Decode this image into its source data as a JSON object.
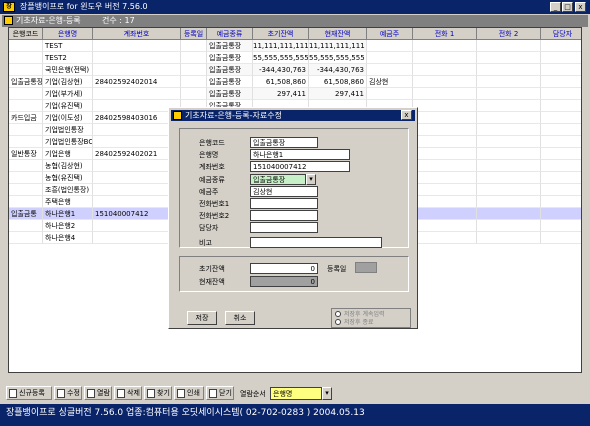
{
  "app_title": "장플뱅이프로 for 윈도우 버전 7.56.0",
  "mdi_title": "기초자료-은행-등록",
  "record_count": "건수 : 17",
  "columns": [
    "은행코드",
    "은행명",
    "계좌번호",
    "등록일",
    "예금종류",
    "초기잔액",
    "현재잔액",
    "예금주",
    "전화 1",
    "전화 2",
    "담당자"
  ],
  "rows": [
    [
      "",
      "TEST",
      "",
      "",
      "입출금통장",
      "11,111,111,111",
      "11,111,111,111",
      "",
      "",
      "",
      ""
    ],
    [
      "",
      "TEST2",
      "",
      "",
      "입출금통장",
      "55,555,555,555",
      "55,555,555,555",
      "",
      "",
      "",
      ""
    ],
    [
      "",
      "국민은행(전택)",
      "",
      "",
      "입출금통장",
      "-344,430,763",
      "-344,430,763",
      "",
      "",
      "",
      ""
    ],
    [
      "입출금통장",
      "기업(김상현)",
      "2840259240​2014",
      "",
      "입출금통장",
      "61,508,860",
      "61,508,860",
      "김상현",
      "",
      "",
      ""
    ],
    [
      "",
      "기업(부가세)",
      "",
      "",
      "입출금통장",
      "297,411",
      "297,411",
      "",
      "",
      "",
      ""
    ],
    [
      "",
      "기업(유진택)",
      "",
      "",
      "입출금통장",
      "",
      "",
      "",
      "",
      "",
      ""
    ],
    [
      "카드입금",
      "기업(이도성)",
      "284025984​03016",
      "",
      "",
      "",
      "",
      "",
      "",
      "",
      ""
    ],
    [
      "",
      "기업법인통장",
      "",
      "",
      "",
      "",
      "",
      "",
      "",
      "",
      ""
    ],
    [
      "",
      "기업법인통장BC",
      "",
      "",
      "",
      "",
      "",
      "",
      "",
      "",
      ""
    ],
    [
      "일반통장",
      "기업은행",
      "28402592402021",
      "",
      "",
      "",
      "",
      "",
      "",
      "",
      ""
    ],
    [
      "",
      "농협(김상현)",
      "",
      "",
      "",
      "",
      "",
      "",
      "",
      "",
      ""
    ],
    [
      "",
      "농협(유진택)",
      "",
      "",
      "",
      "",
      "",
      "",
      "",
      "",
      ""
    ],
    [
      "",
      "조흥(법인통장)",
      "",
      "",
      "",
      "",
      "",
      "",
      "",
      "",
      ""
    ],
    [
      "",
      "주택은행",
      "",
      "",
      "",
      "",
      "",
      "",
      "",
      "",
      ""
    ],
    [
      "입출금통",
      "하나은행1",
      "151040007412",
      "",
      "",
      "",
      "",
      "",
      "",
      "",
      ""
    ],
    [
      "",
      "하나은행2",
      "",
      "",
      "",
      "",
      "",
      "",
      "",
      "",
      ""
    ],
    [
      "",
      "하나은행4",
      "",
      "",
      "",
      "",
      "",
      "",
      "",
      "",
      ""
    ]
  ],
  "dialog": {
    "title": "기초자료-은행-등록-자료수정",
    "labels": {
      "code": "은행코드",
      "name": "은행명",
      "account": "계좌번호",
      "type": "예금종류",
      "owner": "예금주",
      "tel1": "전화번호1",
      "tel2": "전화번호2",
      "manager": "담당자",
      "memo": "비고",
      "init": "초기잔액",
      "current": "현재잔액",
      "regdate": "등록일"
    },
    "values": {
      "code": "입출금통장",
      "name": "하나은행1",
      "account": "151040007412",
      "type": "입출금통장",
      "owner": "김상현",
      "tel1": "",
      "tel2": "",
      "manager": "",
      "memo": "",
      "init": "0",
      "current": "0"
    },
    "save": "저장",
    "cancel": "취소",
    "opt1": "저장후 계속입력",
    "opt2": "저장후 종료"
  },
  "toolbar": [
    "신규등록",
    "수정",
    "열람",
    "삭제",
    "찾기",
    "인쇄",
    "닫기"
  ],
  "sort_label": "열람순서",
  "sort_value": "은행명",
  "status": "장플뱅이프로 싱글버전 7.56.0   업종:컴퓨터용   오딧세이시스템( 02-702-0283 )   2004.05.13"
}
